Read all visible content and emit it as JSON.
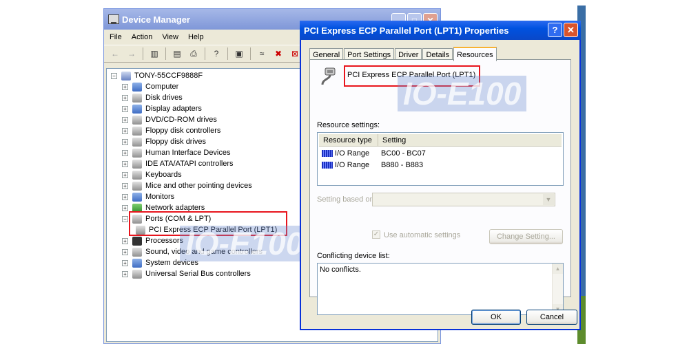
{
  "device_manager": {
    "title": "Device Manager",
    "menu": [
      "File",
      "Action",
      "View",
      "Help"
    ],
    "root": "TONY-55CCF9888F",
    "items": [
      {
        "label": "Computer",
        "icon": "computer-icon",
        "color": "blue"
      },
      {
        "label": "Disk drives",
        "icon": "disk-drive-icon",
        "color": "gray"
      },
      {
        "label": "Display adapters",
        "icon": "display-adapter-icon",
        "color": "blue"
      },
      {
        "label": "DVD/CD-ROM drives",
        "icon": "dvd-drive-icon",
        "color": "gray"
      },
      {
        "label": "Floppy disk controllers",
        "icon": "floppy-controller-icon",
        "color": "gray"
      },
      {
        "label": "Floppy disk drives",
        "icon": "floppy-drive-icon",
        "color": "gray"
      },
      {
        "label": "Human Interface Devices",
        "icon": "hid-icon",
        "color": "gray"
      },
      {
        "label": "IDE ATA/ATAPI controllers",
        "icon": "ide-controller-icon",
        "color": "gray"
      },
      {
        "label": "Keyboards",
        "icon": "keyboard-icon",
        "color": "gray"
      },
      {
        "label": "Mice and other pointing devices",
        "icon": "mouse-icon",
        "color": "gray"
      },
      {
        "label": "Monitors",
        "icon": "monitor-icon",
        "color": "blue"
      },
      {
        "label": "Network adapters",
        "icon": "network-adapter-icon",
        "color": "green"
      },
      {
        "label": "Ports (COM & LPT)",
        "icon": "port-icon",
        "color": "gray",
        "expanded": true
      },
      {
        "label": "PCI Express ECP Parallel Port (LPT1)",
        "icon": "parallel-port-icon",
        "color": "gray",
        "child": true
      },
      {
        "label": "Processors",
        "icon": "processor-icon",
        "color": "dark"
      },
      {
        "label": "Sound, video and game controllers",
        "icon": "sound-icon",
        "color": "gray"
      },
      {
        "label": "System devices",
        "icon": "system-device-icon",
        "color": "blue"
      },
      {
        "label": "Universal Serial Bus controllers",
        "icon": "usb-icon",
        "color": "gray"
      }
    ]
  },
  "dialog": {
    "title": "PCI Express ECP Parallel Port (LPT1) Properties",
    "tabs": [
      "General",
      "Port Settings",
      "Driver",
      "Details",
      "Resources"
    ],
    "active_tab": "Resources",
    "device_name": "PCI Express ECP Parallel Port (LPT1)",
    "resource_settings_label": "Resource settings:",
    "columns": [
      "Resource type",
      "Setting"
    ],
    "resources": [
      {
        "type": "I/O Range",
        "setting": "BC00 - BC07"
      },
      {
        "type": "I/O Range",
        "setting": "B880 - B883"
      }
    ],
    "setting_based_on_label": "Setting based on:",
    "use_automatic_label": "Use automatic settings",
    "change_setting_label": "Change Setting...",
    "conflicting_label": "Conflicting device list:",
    "conflicts_text": "No conflicts.",
    "ok_label": "OK",
    "cancel_label": "Cancel"
  },
  "watermark": "IO-E100",
  "colors": {
    "highlight_box": "#e8141c",
    "title_active": "#0052e0",
    "title_inactive": "#7f97d8"
  }
}
